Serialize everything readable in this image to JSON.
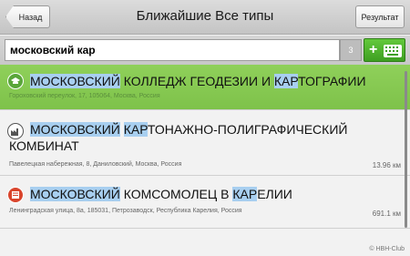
{
  "header": {
    "back_label": "Назад",
    "title": "Ближайшие Все типы",
    "result_label": "Результат"
  },
  "search": {
    "value": "московский кар",
    "count": "3"
  },
  "results": [
    {
      "name_parts": [
        "МОСКОВСКИЙ",
        " КОЛЛЕДЖ ГЕОДЕЗИИ И ",
        "КАР",
        "ТОГРАФИИ"
      ],
      "address": "Гороховский переулок, 17, 105064, Москва, Россия",
      "distance": "",
      "icon": "graduation-icon"
    },
    {
      "name_line1_parts": [
        "МОСКОВСКИЙ",
        " ",
        "КАР",
        "ТОНАЖНО-ПОЛИГРАФИЧЕСКИЙ"
      ],
      "name_line2": "КОМБИНАТ",
      "address": "Павелецкая набережная, 8, Даниловский, Москва, Россия",
      "distance": "13.96 км",
      "icon": "factory-icon"
    },
    {
      "name_parts": [
        "МОСКОВСКИЙ",
        " КОМСОМОЛЕЦ В ",
        "КАР",
        "ЕЛИИ"
      ],
      "address": "Ленинградская улица, 8а, 185031, Петрозаводск, Республика Карелия, Россия",
      "distance": "691.1 км",
      "icon": "newspaper-icon"
    }
  ],
  "watermark": "© HBH-Club",
  "colors": {
    "selected_row": "#8fd05a",
    "highlight": "#a8cff0",
    "keyboard_button": "#4fb52e"
  }
}
